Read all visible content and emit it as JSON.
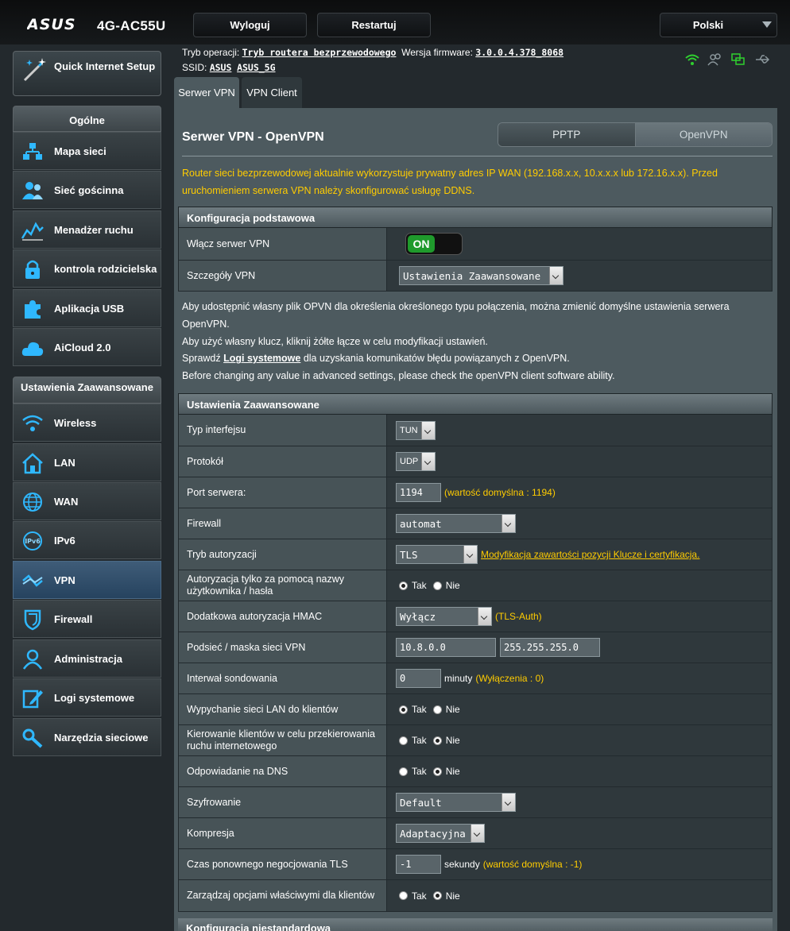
{
  "header": {
    "brand": "ASUS",
    "model": "4G-AC55U",
    "logout_label": "Wyloguj",
    "restart_label": "Restartuj",
    "language": "Polski"
  },
  "info": {
    "mode_label": "Tryb operacji:",
    "mode_value": "Tryb routera bezprzewodowego",
    "firmware_label": "Wersja firmware:",
    "firmware_value": "3.0.0.4.378_8068",
    "ssid_label": "SSID:",
    "ssid1": "ASUS",
    "ssid2": "ASUS_5G"
  },
  "tabs": {
    "server": "Serwer VPN",
    "client": "VPN Client"
  },
  "sidebar": {
    "qis_label": "Quick Internet Setup",
    "general_header": "Ogólne",
    "general_items": [
      "Mapa sieci",
      "Sieć gościnna",
      "Menadżer ruchu",
      "kontrola rodzicielska",
      "Aplikacja USB",
      "AiCloud 2.0"
    ],
    "advanced_header": "Ustawienia Zaawansowane",
    "advanced_items": [
      "Wireless",
      "LAN",
      "WAN",
      "IPv6",
      "VPN",
      "Firewall",
      "Administracja",
      "Logi systemowe",
      "Narzędzia sieciowe"
    ],
    "active_item": "VPN"
  },
  "main": {
    "title": "Serwer VPN - OpenVPN",
    "seg_pptp": "PPTP",
    "seg_openvpn": "OpenVPN",
    "warning": "Router sieci bezprzewodowej aktualnie wykorzystuje prywatny adres IP WAN (192.168.x.x, 10.x.x.x lub 172.16.x.x). Przed uruchomieniem serwera VPN należy skonfigurować usługę DDNS.",
    "basic_header": "Konfiguracja podstawowa",
    "enable_label": "Włącz serwer VPN",
    "enable_value": "ON",
    "details_label": "Szczegóły VPN",
    "details_value": "Ustawienia Zaawansowane",
    "desc1": "Aby udostępnić własny plik OPVN dla określenia określonego typu połączenia, można zmienić domyślne ustawienia serwera OpenVPN.",
    "desc2": "Aby użyć własny klucz, kliknij żółte łącze w celu modyfikacji ustawień.",
    "desc3_pre": "Sprawdź ",
    "desc3_link": "Logi systemowe",
    "desc3_post": " dla uzyskania komunikatów błędu powiązanych z OpenVPN.",
    "desc4": "Before changing any value in advanced settings, please check the openVPN client software ability.",
    "adv_header": "Ustawienia Zaawansowane",
    "bottom_header": "Konfiguracja niestandardowa"
  },
  "adv": {
    "iface_label": "Typ interfejsu",
    "iface_value": "TUN",
    "proto_label": "Protokół",
    "proto_value": "UDP",
    "port_label": "Port serwera:",
    "port_value": "1194",
    "port_hint": "(wartość domyślna : 1194)",
    "fw_label": "Firewall",
    "fw_value": "automat",
    "auth_label": "Tryb autoryzacji",
    "auth_value": "TLS",
    "auth_link": "Modyfikacja zawartości pozycji Klucze i certyfikacja.",
    "userauth_label": "Autoryzacja tylko za pomocą nazwy użytkownika / hasła",
    "hmac_label": "Dodatkowa autoryzacja HMAC",
    "hmac_value": "Wyłącz",
    "hmac_hint": "(TLS-Auth)",
    "subnet_label": "Podsieć / maska sieci VPN",
    "subnet_value": "10.8.0.0",
    "mask_value": "255.255.255.0",
    "poll_label": "Interwał sondowania",
    "poll_value": "0",
    "poll_unit": "minuty",
    "poll_hint": "(Wyłączenia : 0)",
    "pushlan_label": "Wypychanie sieci LAN do klientów",
    "redirect_label": "Kierowanie klientów w celu przekierowania ruchu internetowego",
    "dns_label": "Odpowiadanie na DNS",
    "cipher_label": "Szyfrowanie",
    "cipher_value": "Default",
    "comp_label": "Kompresja",
    "comp_value": "Adaptacyjna",
    "reneg_label": "Czas ponownego negocjowania TLS",
    "reneg_value": "-1",
    "reneg_unit": "sekundy",
    "reneg_hint": "(wartość domyślna : -1)",
    "ccd_label": "Zarządzaj opcjami właściwymi dla klientów",
    "yes": "Tak",
    "no": "Nie"
  }
}
